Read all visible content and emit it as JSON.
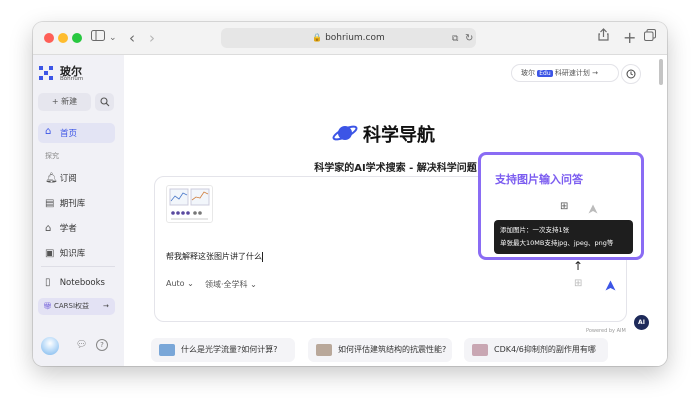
{
  "browser": {
    "url": "bohrium.com"
  },
  "sidebar": {
    "logo_name": "玻尔",
    "logo_sub": "Bohrium",
    "new_button": "+ 新建",
    "home": "首页",
    "section_label": "探究",
    "items": [
      "订阅",
      "期刊库",
      "学者",
      "知识库",
      "Notebooks"
    ],
    "cars_label": "CARSI权益"
  },
  "header": {
    "chip_prefix": "玻尔",
    "chip_badge": "Edu",
    "chip_text": "科研速计划 →"
  },
  "hero": {
    "title": "科学导航",
    "subtitle": "科学家的AI学术搜索 - 解决科学问题"
  },
  "input": {
    "text": "帮我解释这张图片讲了什么",
    "mode": "Auto",
    "domain": "领域·全学科",
    "powered_by": "Powered by AIM"
  },
  "suggestions": [
    "什么是光学流量?如何计算?",
    "如何评估建筑结构的抗震性能?",
    "CDK4/6抑制剂的副作用有哪些?"
  ],
  "annotation": {
    "title": "支持图片输入问答",
    "tooltip_line1": "添加图片：一次支持1张",
    "tooltip_line2": "单张最大10MB支持jpg、jpeg、png等"
  },
  "colors": {
    "accent": "#3c55e6",
    "annotation": "#8a6cf4"
  }
}
